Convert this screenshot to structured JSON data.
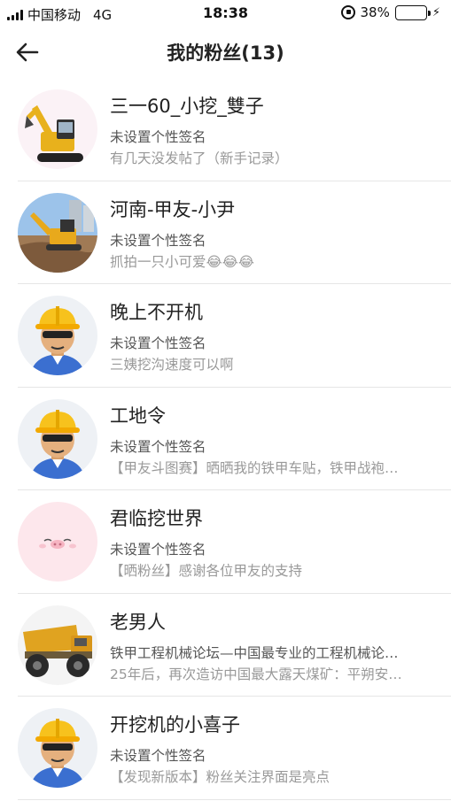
{
  "status_bar": {
    "carrier": "中国移动",
    "network": "4G",
    "time": "18:38",
    "battery": "38%",
    "battery_level": 0.38
  },
  "nav": {
    "title": "我的粉丝(13)"
  },
  "fans": [
    {
      "name": "三一60_小挖_雙子",
      "signature": "未设置个性签名",
      "latest_post": "有几天没发帖了（新手记录）",
      "avatar": "excavator-photo"
    },
    {
      "name": "河南-甲友-小尹",
      "signature": "未设置个性签名",
      "latest_post": "抓拍一只小可爱😂😂😂",
      "avatar": "excavator-site-photo"
    },
    {
      "name": "晚上不开机",
      "signature": "未设置个性签名",
      "latest_post": "三姨挖沟速度可以啊",
      "avatar": "worker-helmet-avatar"
    },
    {
      "name": "工地令",
      "signature": "未设置个性签名",
      "latest_post": "【甲友斗图赛】晒晒我的铁甲车贴，铁甲战袍…",
      "avatar": "worker-helmet-avatar"
    },
    {
      "name": "君临挖世界",
      "signature": "未设置个性签名",
      "latest_post": "【晒粉丝】感谢各位甲友的支持",
      "avatar": "pig-face-avatar"
    },
    {
      "name": "老男人",
      "signature": "铁甲工程机械论坛—中国最专业的工程机械论…",
      "latest_post": "25年后，再次造访中国最大露天煤矿：平朔安…",
      "avatar": "dump-truck-photo"
    },
    {
      "name": "开挖机的小喜子",
      "signature": "未设置个性签名",
      "latest_post": "【发现新版本】粉丝关注界面是亮点",
      "avatar": "worker-helmet-avatar"
    }
  ]
}
